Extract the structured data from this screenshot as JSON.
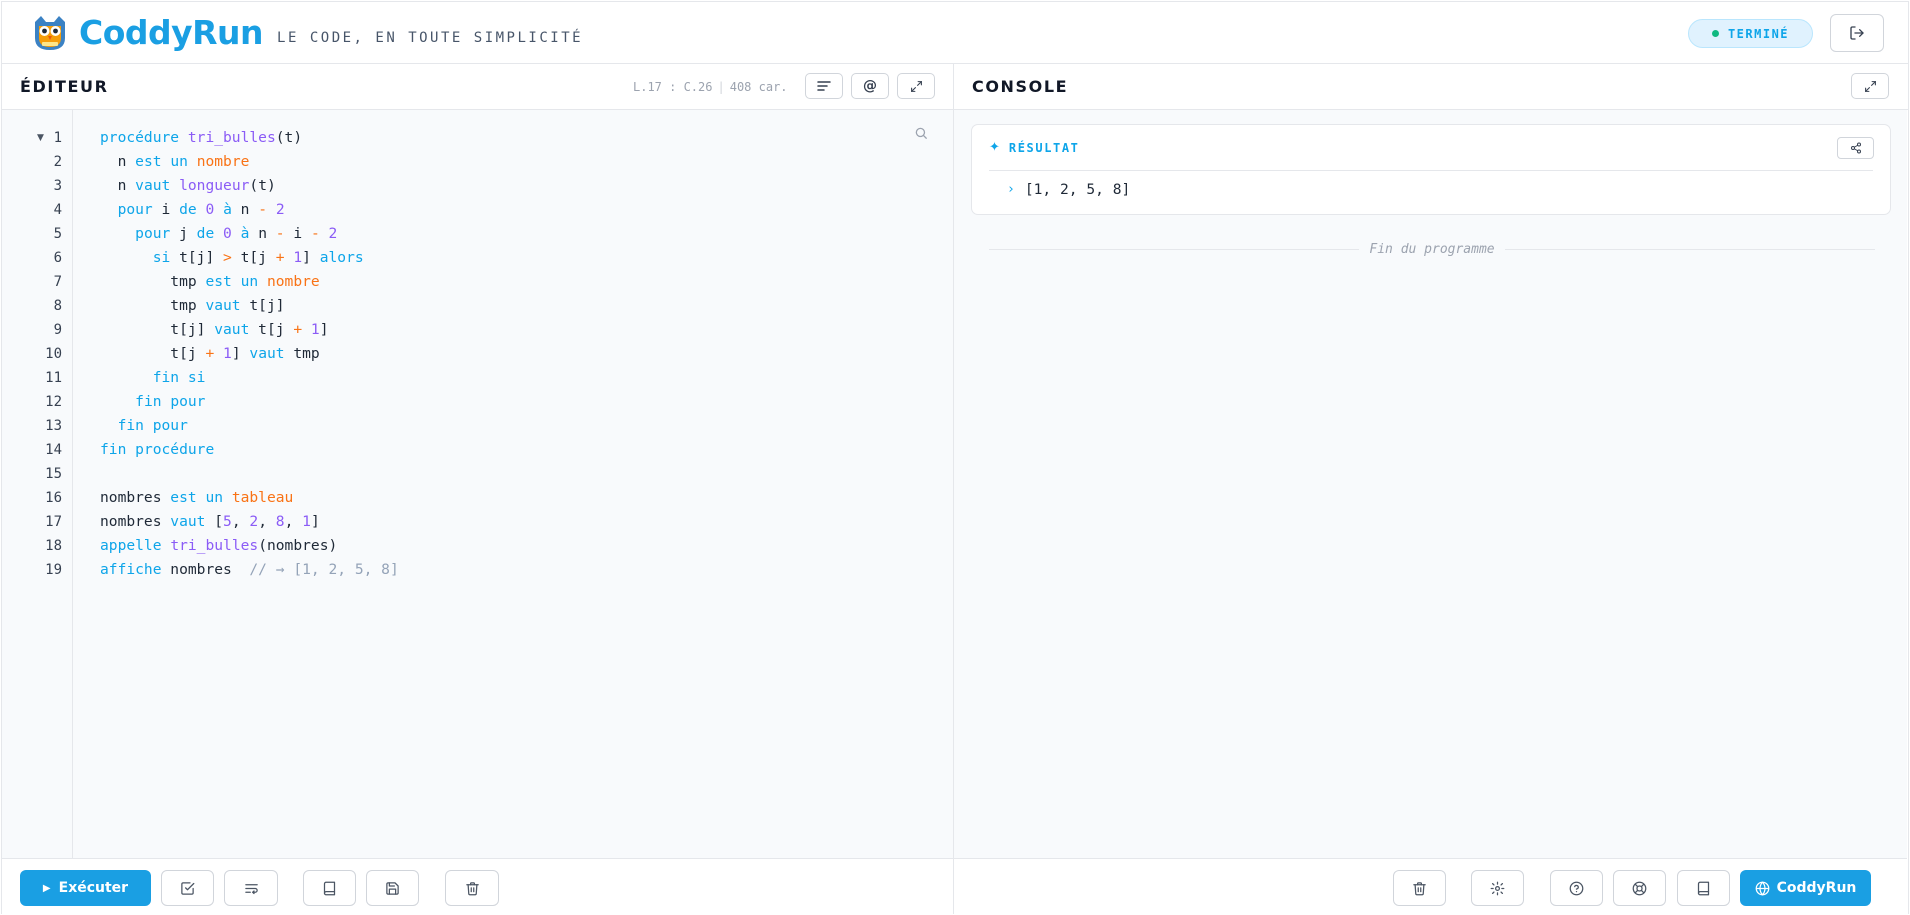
{
  "app": {
    "brand": "CoddyRun",
    "tagline": "LE CODE, EN TOUTE SIMPLICITÉ",
    "status": "TERMINÉ",
    "logo_icon": "owl-icon",
    "colors": {
      "accent": "#1a9fe3",
      "keyword": "#0ea5e9",
      "function": "#8b5cf6",
      "type": "#f97316",
      "comment": "#94a3b8",
      "status_dot": "#10b981"
    }
  },
  "editor": {
    "title": "ÉDITEUR",
    "cursor": "L.17 : C.26",
    "char_count": "408 car.",
    "line_numbers": [
      "1",
      "2",
      "3",
      "4",
      "5",
      "6",
      "7",
      "8",
      "9",
      "10",
      "11",
      "12",
      "13",
      "14",
      "15",
      "16",
      "17",
      "18",
      "19"
    ],
    "code_lines": [
      "procédure tri_bulles(t)",
      "  n est un nombre",
      "  n vaut longueur(t)",
      "  pour i de 0 à n - 2",
      "    pour j de 0 à n - i - 2",
      "      si t[j] > t[j + 1] alors",
      "        tmp est un nombre",
      "        tmp vaut t[j]",
      "        t[j] vaut t[j + 1]",
      "        t[j + 1] vaut tmp",
      "      fin si",
      "    fin pour",
      "  fin pour",
      "fin procédure",
      "",
      "nombres est un tableau",
      "nombres vaut [5, 2, 8, 1]",
      "appelle tri_bulles(nombres)",
      "affiche nombres  // → [1, 2, 5, 8]"
    ],
    "run_label": "Exécuter",
    "toolbar_icons": [
      "check-icon",
      "format-icon",
      "book-icon",
      "save-icon",
      "trash-icon"
    ]
  },
  "console": {
    "title": "CONSOLE",
    "result_title": "RÉSULTAT",
    "result_value": "[1, 2, 5, 8]",
    "end_text": "Fin du programme",
    "coddy_label": "CoddyRun",
    "toolbar_icons": [
      "trash-icon",
      "gear-icon",
      "help-icon",
      "lifebuoy-icon",
      "book-icon",
      "globe-icon"
    ]
  }
}
